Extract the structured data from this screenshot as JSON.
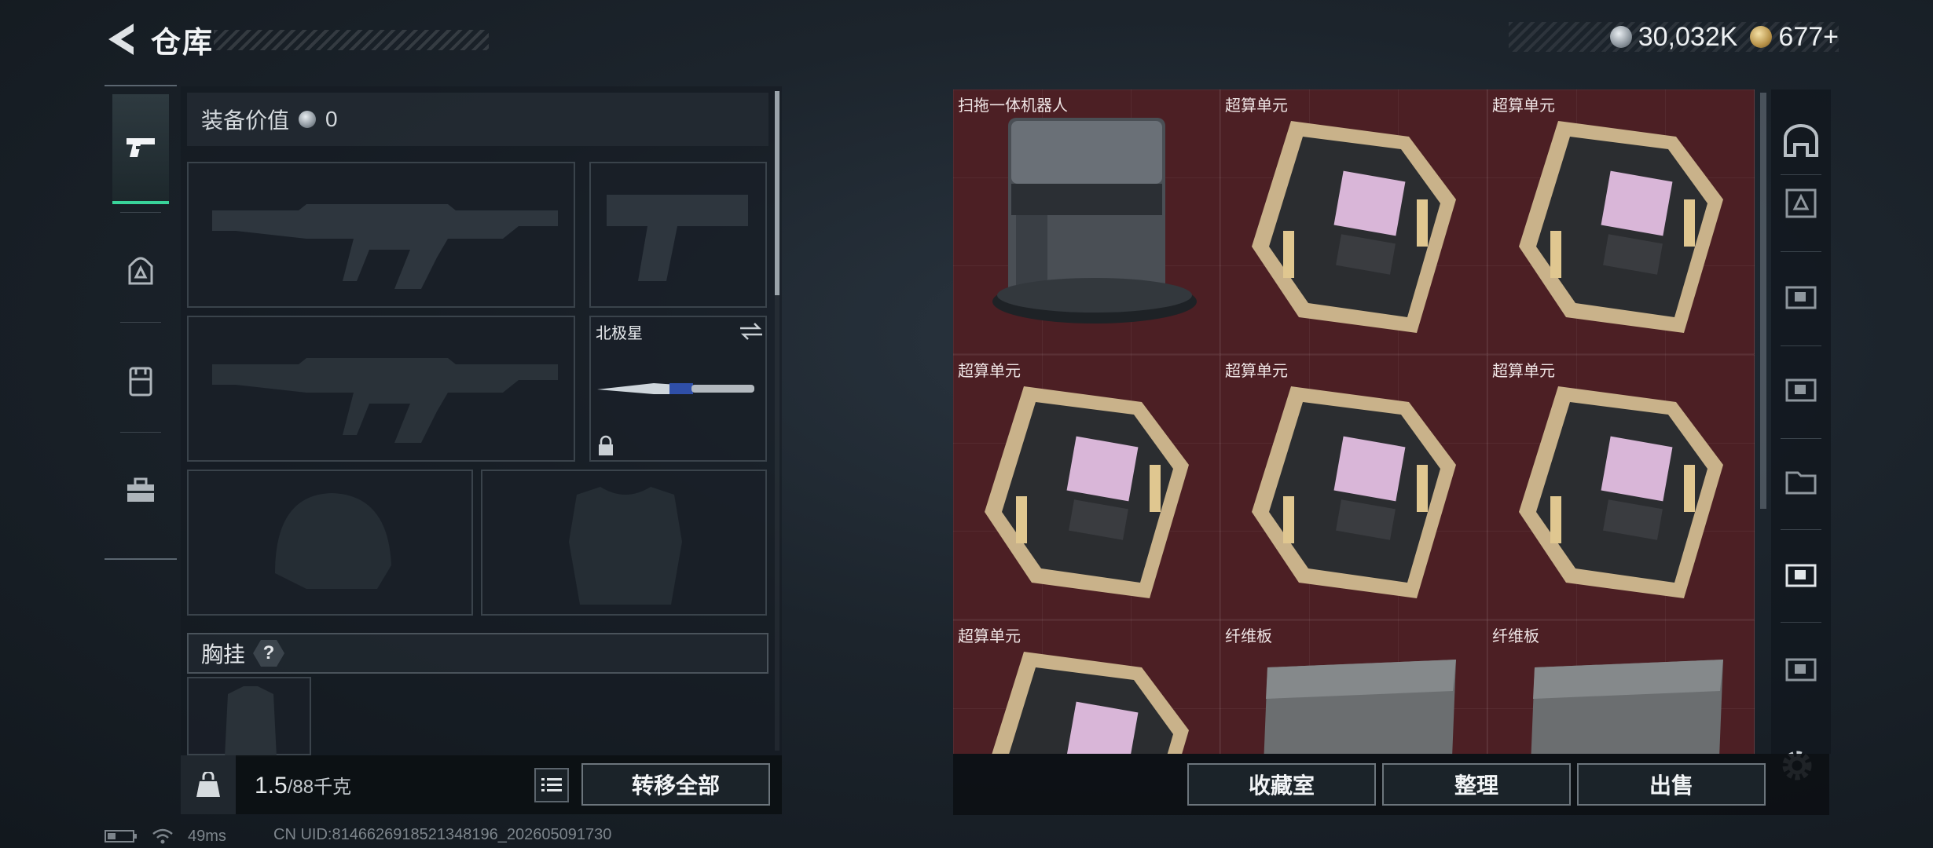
{
  "header": {
    "title": "仓库",
    "currency": [
      {
        "icon": "silver-coin-icon",
        "value": "30,032K"
      },
      {
        "icon": "gold-coin-icon",
        "value": "677+"
      }
    ]
  },
  "left_nav": {
    "items": [
      {
        "icon": "pistol-icon",
        "active": true
      },
      {
        "icon": "backpack-icon",
        "active": false
      },
      {
        "icon": "vest-icon",
        "active": false
      },
      {
        "icon": "toolbox-icon",
        "active": false
      }
    ]
  },
  "loadout": {
    "equip_value_label": "装备价值",
    "equip_value": "0",
    "melee_name": "北极星",
    "chest_rig_label": "胸挂",
    "chest_rig_help": "?",
    "weight_value": "1.5",
    "weight_capacity": "/88千克",
    "transfer_all_label": "转移全部"
  },
  "stash": {
    "items": [
      {
        "name": "扫拖一体机器人",
        "type": "robot"
      },
      {
        "name": "超算单元",
        "type": "chip"
      },
      {
        "name": "超算单元",
        "type": "chip"
      },
      {
        "name": "超算单元",
        "type": "chip"
      },
      {
        "name": "超算单元",
        "type": "chip"
      },
      {
        "name": "超算单元",
        "type": "chip"
      },
      {
        "name": "超算单元",
        "type": "chip"
      },
      {
        "name": "纤维板",
        "type": "board"
      },
      {
        "name": "纤维板",
        "type": "board"
      }
    ],
    "buttons": {
      "collection_label": "收藏室",
      "sort_label": "整理",
      "sell_label": "出售"
    }
  },
  "status": {
    "ping": "49ms",
    "uid": "CN UID:8146626918521348196_202605091730"
  },
  "colors": {
    "accent": "#39d39a",
    "stash_bg": "#4c1f24"
  }
}
